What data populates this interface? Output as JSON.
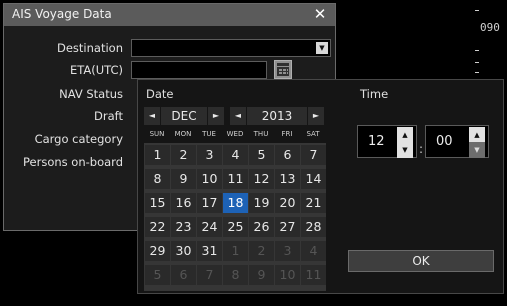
{
  "radar": {
    "bearing_label": "090"
  },
  "dialog": {
    "title": "AIS Voyage Data",
    "close_icon": "close-icon",
    "fields": {
      "destination": {
        "label": "Destination",
        "value": ""
      },
      "eta": {
        "label": "ETA(UTC)",
        "value": ""
      },
      "nav_status": {
        "label": "NAV Status"
      },
      "draft": {
        "label": "Draft"
      },
      "cargo_category": {
        "label": "Cargo category"
      },
      "persons_on_board": {
        "label": "Persons on-board"
      }
    }
  },
  "picker": {
    "date_label": "Date",
    "time_label": "Time",
    "month": "DEC",
    "year": "2013",
    "weekdays": [
      "SUN",
      "MON",
      "TUE",
      "WED",
      "THU",
      "FRI",
      "SAT"
    ],
    "weeks": [
      [
        "1",
        "2",
        "3",
        "4",
        "5",
        "6",
        "7"
      ],
      [
        "8",
        "9",
        "10",
        "11",
        "12",
        "13",
        "14"
      ],
      [
        "15",
        "16",
        "17",
        "18",
        "19",
        "20",
        "21"
      ],
      [
        "22",
        "23",
        "24",
        "25",
        "26",
        "27",
        "28"
      ],
      [
        "29",
        "30",
        "31",
        "1",
        "2",
        "3",
        "4"
      ],
      [
        "5",
        "6",
        "7",
        "8",
        "9",
        "10",
        "11"
      ]
    ],
    "selected_day": "18",
    "hour": "12",
    "minute": "00",
    "colon": ":",
    "ok_label": "OK",
    "icons": {
      "prev": "triangle-left-icon",
      "next": "triangle-right-icon",
      "up": "triangle-up-icon",
      "down": "triangle-down-icon"
    }
  },
  "colors": {
    "selected_day": "#1d62b6",
    "titlebar": "#5b5b5b"
  }
}
